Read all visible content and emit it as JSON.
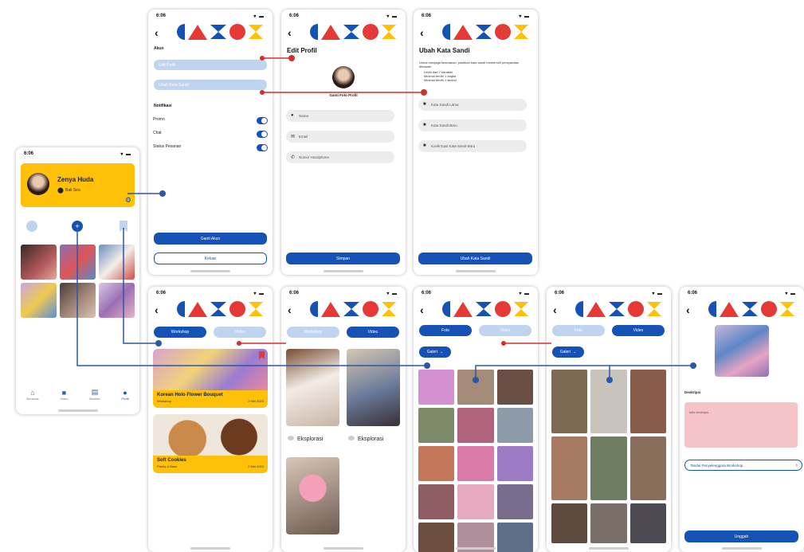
{
  "status": {
    "time": "6:06",
    "icons": "▾ ▬"
  },
  "colors": {
    "brand_blue": "#1652b5",
    "yellow": "#ffc107",
    "red": "#e53935",
    "light_blue": "#bfd5ef",
    "connector_blue": "#2b58a6",
    "connector_red": "#d32f2f"
  },
  "profile": {
    "name": "Zenya Huda",
    "location": "Bali Sea",
    "nav": [
      {
        "label": "Beranda",
        "icon": "home-icon"
      },
      {
        "label": "Video",
        "icon": "video-icon"
      },
      {
        "label": "Booklet",
        "icon": "booklet-icon"
      },
      {
        "label": "Profil",
        "icon": "profile-icon"
      }
    ]
  },
  "settings": {
    "section_akun": "Akun",
    "item_edit_profil": "Edit Profil",
    "item_ubah_sandi": "Ubah Kata Sandi",
    "section_notif": "Notifikasi",
    "notif_promo": "Promo",
    "notif_chat": "Chat",
    "notif_status": "Status Pesanan",
    "btn_ganti_akun": "Ganti Akun",
    "btn_keluar": "Keluar"
  },
  "edit_profil": {
    "title": "Edit Profil",
    "photo_label": "Ganti Foto Profil",
    "nama_placeholder": "Nama",
    "email_placeholder": "Email",
    "hp_placeholder": "Nomor Handphone",
    "btn_simpan": "Simpan"
  },
  "ubah_sandi": {
    "title": "Ubah Kata Sandi",
    "desc": "Untuk menjaga keamanan, pastikan kata sandi memenuhi persyaratan dibawah:",
    "rules": [
      "Lebih dari 7 karakter",
      "Minimal terdiri 1 angka",
      "Minimal terdiri 1 simbol"
    ],
    "old_placeholder": "Kata Sandi Lama",
    "new_placeholder": "Kata Sandi Baru",
    "confirm_placeholder": "Konfirmasi Kata Sandi Baru",
    "btn": "Ubah Kata Sandi"
  },
  "workshop_list": {
    "tab_workshop": "Workshop",
    "tab_video": "Video",
    "cards": [
      {
        "title": "Korean Holo Flower Bouquet",
        "sub": "Workshop",
        "date": "2 Mei 2023"
      },
      {
        "title": "Soft Cookies",
        "sub": "Pastry & Bake",
        "date": "2 Mei 2023"
      }
    ]
  },
  "video_list": {
    "tab_workshop": "Workshop",
    "tab_video": "Video",
    "label_a": "Eksplorasi",
    "label_b": "Eksplorasi"
  },
  "gallery_foto": {
    "tab_foto": "Foto",
    "tab_video": "Video",
    "dropdown": "Galeri"
  },
  "gallery_video": {
    "tab_foto": "Foto",
    "tab_video": "Video",
    "dropdown": "Galeri"
  },
  "upload": {
    "desc_label": "Deskripsi",
    "desc_placeholder": "tulis deskripsi...",
    "tag_btn": "Tandai Penyelenggara Workshop",
    "btn_unggah": "Unggah"
  }
}
